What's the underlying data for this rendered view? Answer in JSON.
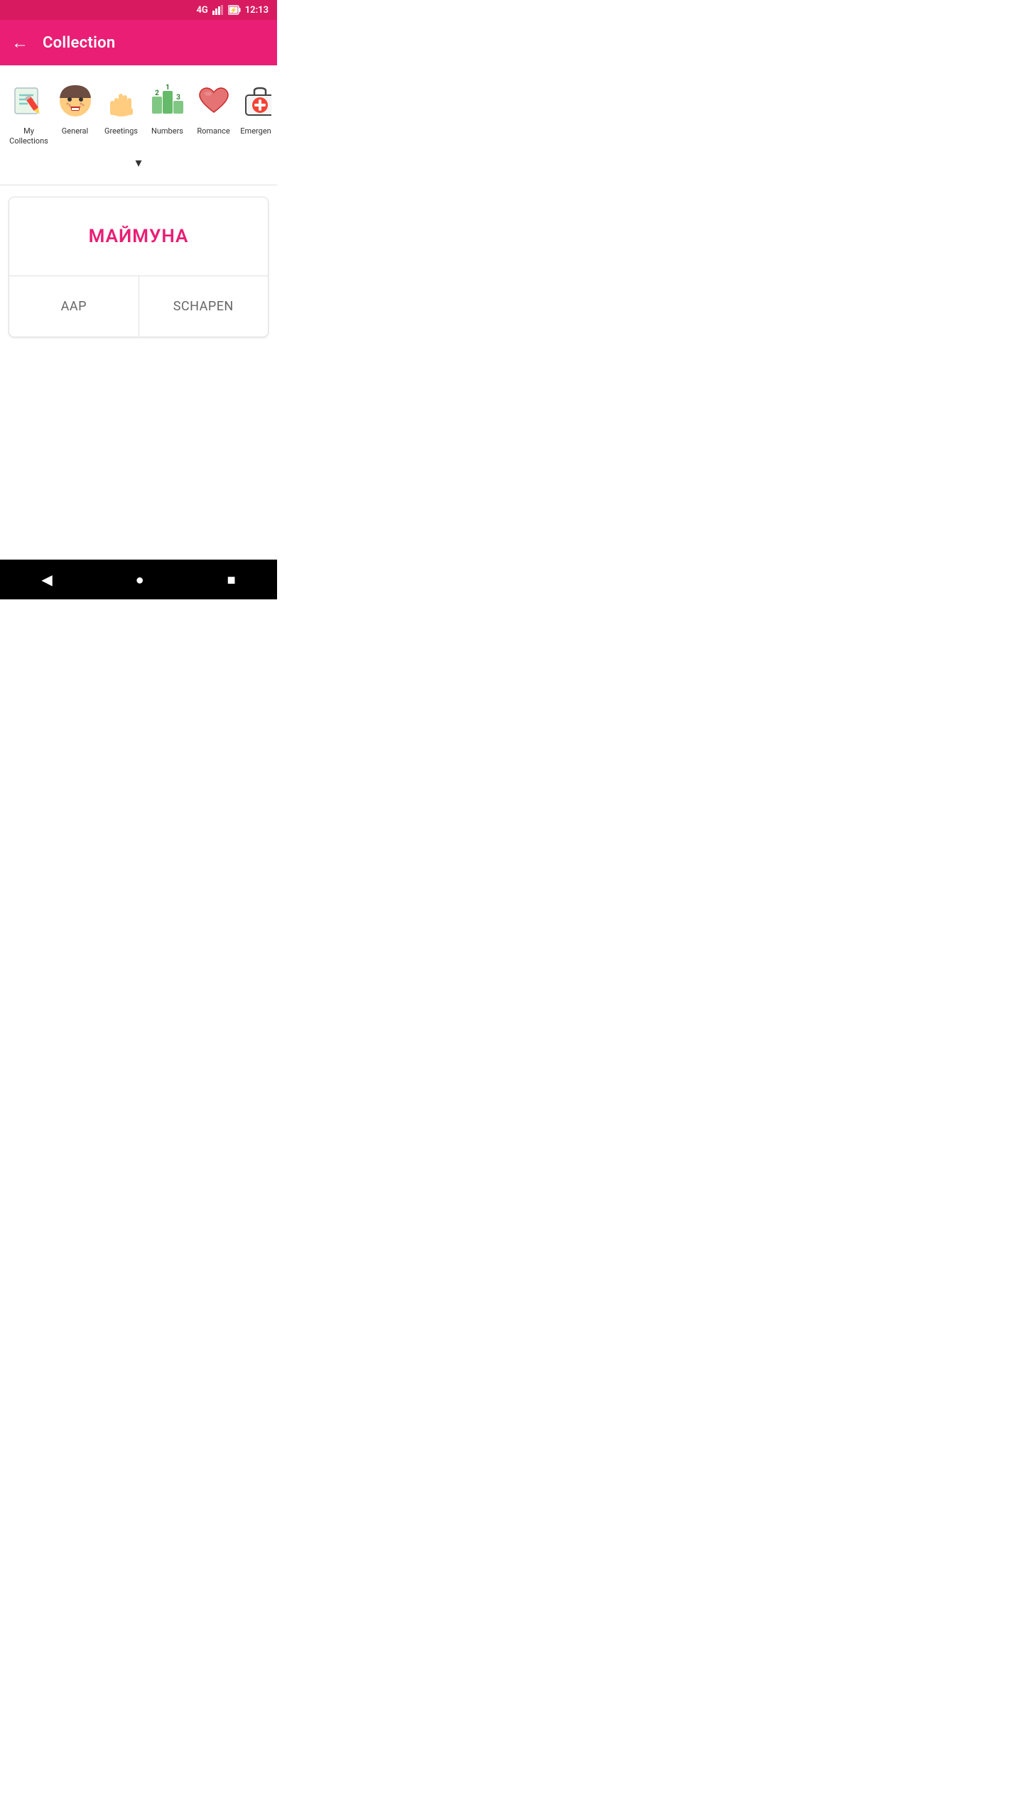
{
  "statusBar": {
    "signal": "4G",
    "time": "12:13"
  },
  "header": {
    "backLabel": "←",
    "title": "Collection"
  },
  "categories": [
    {
      "id": "my-collections",
      "label": "My Collections",
      "iconType": "my-collections"
    },
    {
      "id": "general",
      "label": "General",
      "iconType": "general"
    },
    {
      "id": "greetings",
      "label": "Greetings",
      "iconType": "greetings"
    },
    {
      "id": "numbers",
      "label": "Numbers",
      "iconType": "numbers"
    },
    {
      "id": "romance",
      "label": "Romance",
      "iconType": "romance"
    },
    {
      "id": "emergency",
      "label": "Emergency",
      "iconType": "emergency"
    }
  ],
  "card": {
    "mainWord": "МАЙМУНА",
    "optionA": "AAP",
    "optionB": "SCHAPEN"
  },
  "navBar": {
    "backIcon": "◀",
    "homeIcon": "●",
    "recentIcon": "■"
  }
}
